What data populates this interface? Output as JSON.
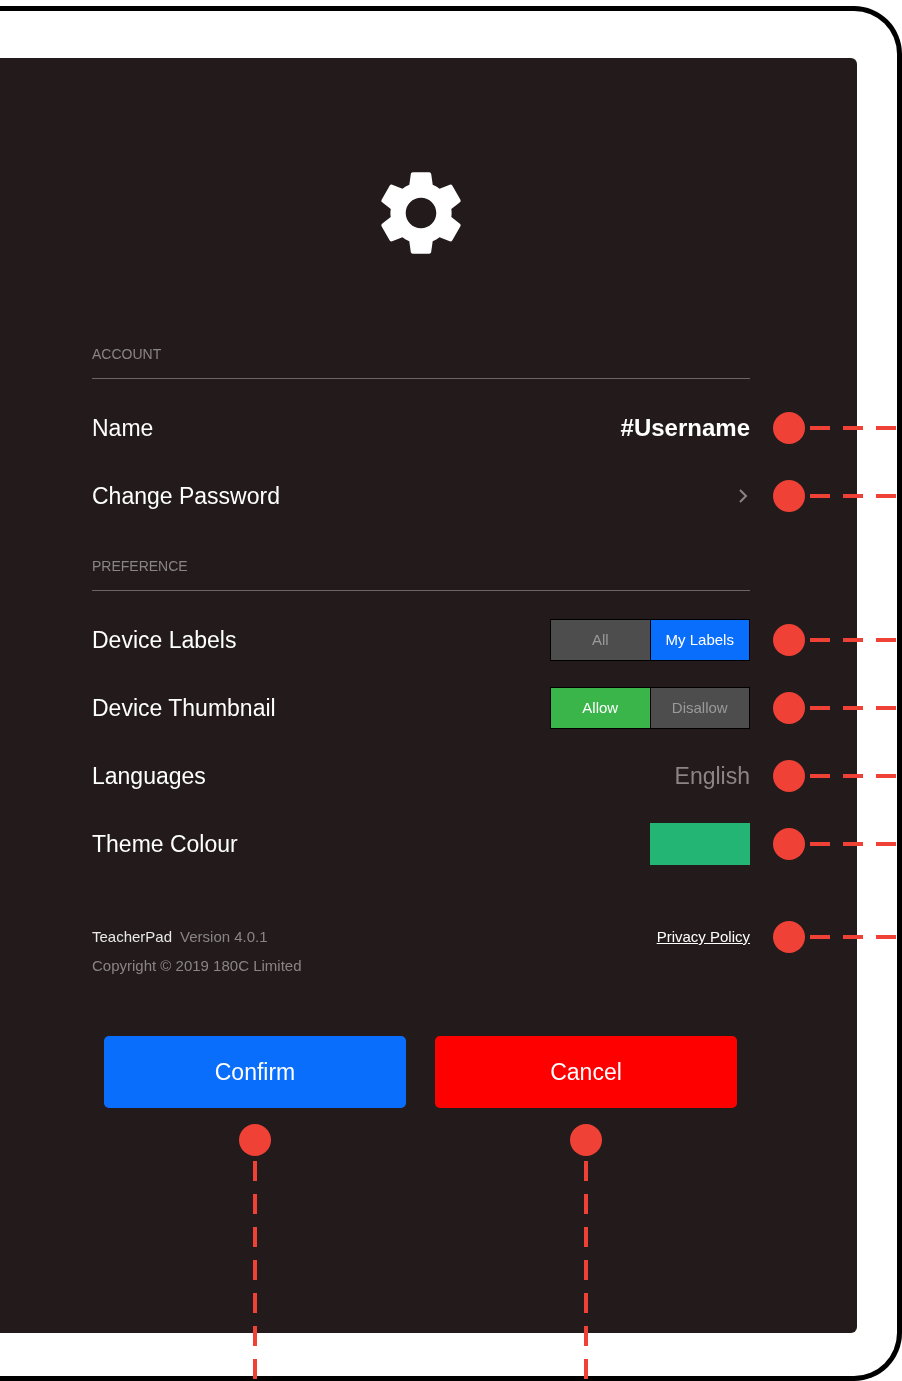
{
  "sections": [
    {
      "header": "ACCOUNT",
      "rows": [
        {
          "kind": "username",
          "label": "Name",
          "value": "#Username"
        },
        {
          "kind": "link",
          "label": "Change Password"
        }
      ]
    },
    {
      "header": "PREFERENCE",
      "rows": [
        {
          "kind": "segmented",
          "label": "Device Labels",
          "color": "#0a6efd",
          "options": [
            {
              "label": "All",
              "selected": false
            },
            {
              "label": "My Labels",
              "selected": true
            }
          ]
        },
        {
          "kind": "segmented",
          "label": "Device Thumbnail",
          "color": "#39b54a",
          "options": [
            {
              "label": "Allow",
              "selected": true
            },
            {
              "label": "Disallow",
              "selected": false
            }
          ]
        },
        {
          "kind": "option",
          "label": "Languages",
          "value": "English"
        },
        {
          "kind": "swatch",
          "label": "Theme Colour",
          "color": "#22b573"
        }
      ]
    }
  ],
  "footer": {
    "app_name": "TeacherPad",
    "version": "Version 4.0.1",
    "copyright": "Copyright © 2019 180C Limited",
    "link": "Privacy Policy"
  },
  "buttons": [
    {
      "kind": "primary",
      "label": "Confirm"
    },
    {
      "kind": "danger",
      "label": "Cancel"
    }
  ]
}
